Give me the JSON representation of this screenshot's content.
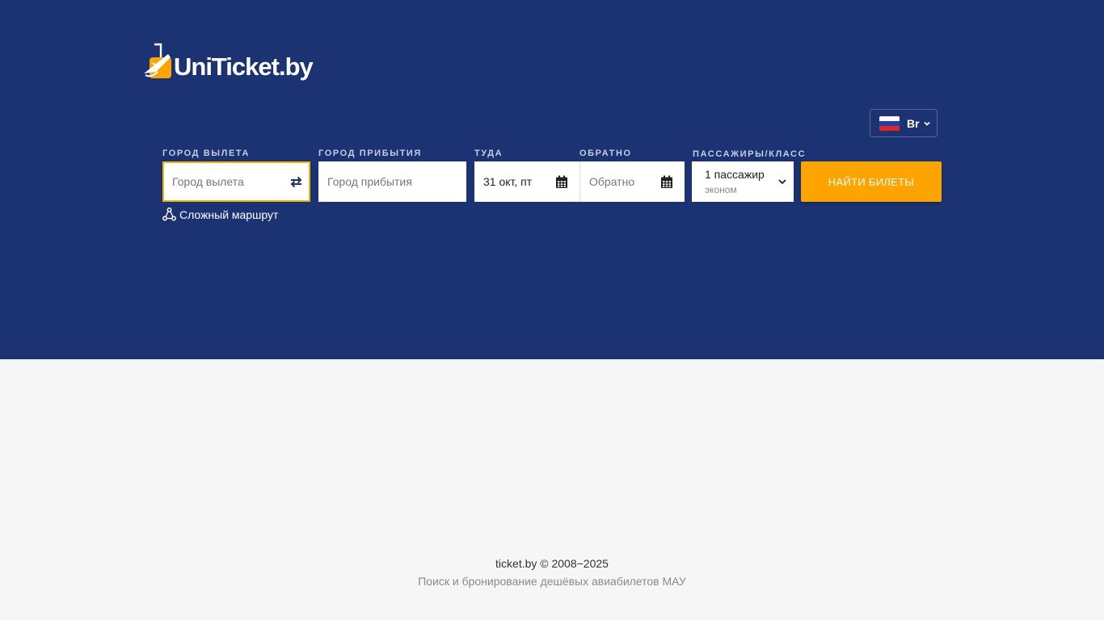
{
  "logo": {
    "text": "UniTicket.by"
  },
  "currency": {
    "label": "Br",
    "flag_colors": [
      "#ffffff",
      "#1c3faa",
      "#e52421"
    ]
  },
  "search": {
    "from": {
      "label": "ГОРОД ВЫЛЕТА",
      "placeholder": "Город вылета",
      "value": ""
    },
    "to": {
      "label": "ГОРОД ПРИБЫТИЯ",
      "placeholder": "Город прибытия",
      "value": ""
    },
    "depart": {
      "label": "ТУДА",
      "value": "31 окт, пт"
    },
    "return": {
      "label": "ОБРАТНО",
      "placeholder": "Обратно"
    },
    "passengers": {
      "label": "ПАССАЖИРЫ/КЛАСС",
      "count_text": "1 пассажир",
      "class_text": "эконом"
    },
    "submit_label": "НАЙТИ БИЛЕТЫ",
    "complex_route_label": "Сложный маршрут"
  },
  "icons": {
    "swap": "swap-arrows-icon",
    "calendar": "calendar-icon",
    "chevron": "chevron-down-icon",
    "route": "route-icon"
  },
  "colors": {
    "hero_bg": "#1b3372",
    "accent": "#fea400",
    "focus_border": "#f7b500",
    "page_bg": "#f6f6f6"
  },
  "footer": {
    "copyright": "ticket.by © 2008−2025",
    "tagline": "Поиск и бронирование дешёвых авиабилетов МАУ"
  }
}
